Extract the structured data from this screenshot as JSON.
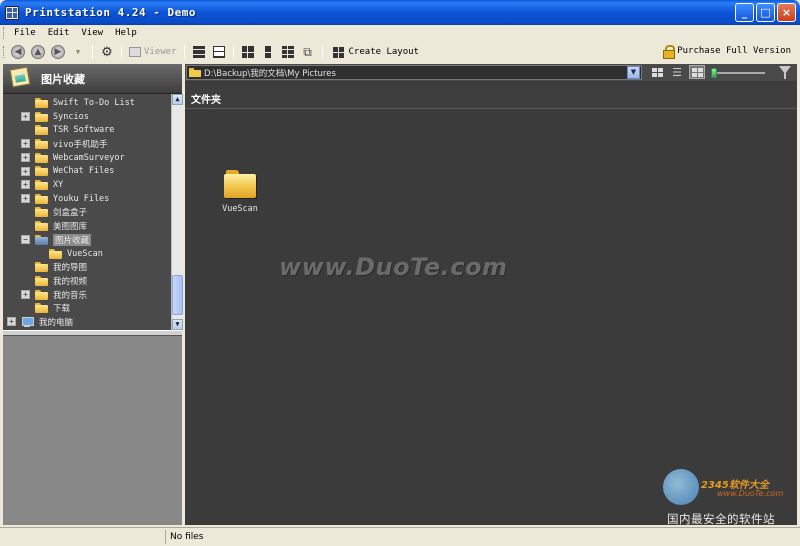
{
  "window": {
    "title": "Printstation 4.24 - Demo",
    "minimize": "_",
    "maximize": "□",
    "close": "×"
  },
  "menu": [
    "File",
    "Edit",
    "View",
    "Help"
  ],
  "toolbar": {
    "viewer_label": "Viewer",
    "create_layout_label": "Create Layout",
    "purchase_label": "Purchase Full Version"
  },
  "sidebar": {
    "title": "图片收藏",
    "tree": [
      {
        "label": "Swift To-Do List",
        "expandable": false
      },
      {
        "label": "Syncios",
        "expandable": true
      },
      {
        "label": "TSR Software",
        "expandable": false
      },
      {
        "label": "vivo手机助手",
        "expandable": true
      },
      {
        "label": "WebcamSurveyor",
        "expandable": true
      },
      {
        "label": "WeChat Files",
        "expandable": true
      },
      {
        "label": "XY",
        "expandable": true
      },
      {
        "label": "Youku Files",
        "expandable": true
      },
      {
        "label": "剑盒盒子",
        "expandable": false
      },
      {
        "label": "美图图库",
        "expandable": false
      },
      {
        "label": "图片收藏",
        "expandable": true,
        "expanded": true,
        "selected": true
      },
      {
        "label": "VueScan",
        "expandable": false,
        "child": true
      },
      {
        "label": "我的导图",
        "expandable": false
      },
      {
        "label": "我的视频",
        "expandable": false
      },
      {
        "label": "我的音乐",
        "expandable": true
      },
      {
        "label": "下载",
        "expandable": false
      },
      {
        "label": "我的电脑",
        "expandable": true,
        "computer": true
      }
    ]
  },
  "path": {
    "value": "D:\\Backup\\我的文档\\My Pictures"
  },
  "main": {
    "section_title": "文件夹",
    "folders": [
      {
        "name": "VueScan"
      }
    ],
    "watermark": "www.DuoTe.com",
    "logo": {
      "brand": "2345软件大全",
      "url": "www.DuoTe.com",
      "tagline": "国内最安全的软件站"
    }
  },
  "status": {
    "left": "",
    "message": "No files"
  }
}
